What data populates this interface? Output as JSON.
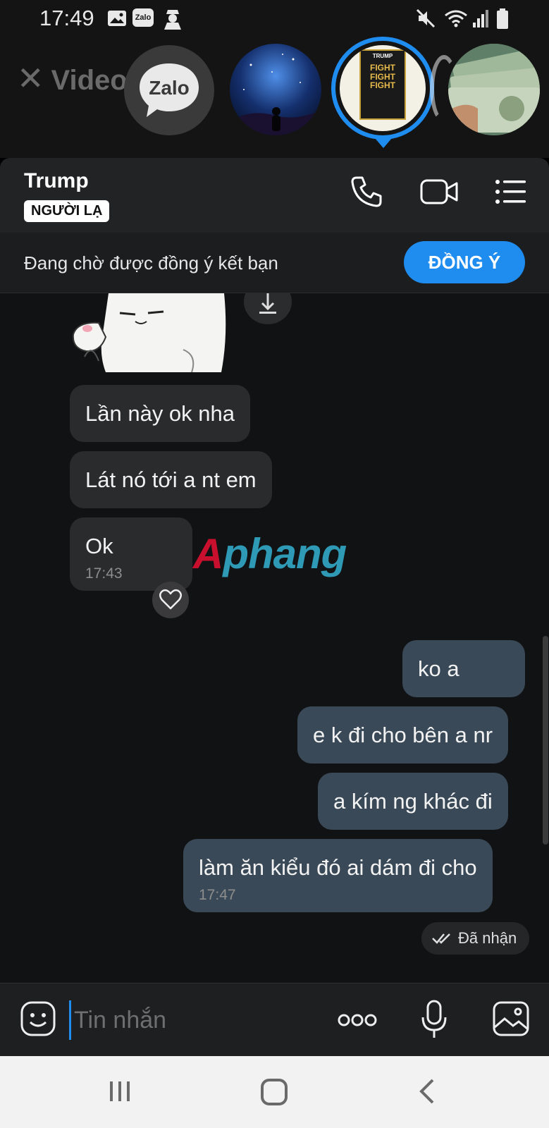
{
  "status_bar": {
    "time": "17:49",
    "zalo_badge": "Zalo"
  },
  "strip": {
    "close_video_label": "Video",
    "zalo_logo_text": "Zalo",
    "avatar_poster_top": "TRUMP",
    "avatar_poster_main": "FIGHT FIGHT FIGHT"
  },
  "header": {
    "contact_name": "Trump",
    "stranger_badge": "NGƯỜI LẠ"
  },
  "friend_request": {
    "text": "Đang chờ được đồng ý kết bạn",
    "accept_label": "ĐỒNG Ý"
  },
  "messages": {
    "incoming": [
      {
        "text": "Lần này ok nha"
      },
      {
        "text": "Lát nó tới a nt em"
      },
      {
        "text": "Ok",
        "time": "17:43"
      }
    ],
    "outgoing": [
      {
        "text": "ko a"
      },
      {
        "text": "e k đi cho bên a nr"
      },
      {
        "text": "a kím ng khác đi"
      },
      {
        "text": "làm ăn kiểu đó ai dám đi cho",
        "time": "17:47"
      }
    ],
    "delivery_status": "Đã nhận"
  },
  "watermark": {
    "part1": "A",
    "part2": "phang"
  },
  "composer": {
    "placeholder": "Tin nhắn"
  },
  "colors": {
    "accent": "#1f8cf0",
    "incoming_bubble": "#2a2b2d",
    "outgoing_bubble": "#3a4957",
    "chat_background": "#111214"
  }
}
